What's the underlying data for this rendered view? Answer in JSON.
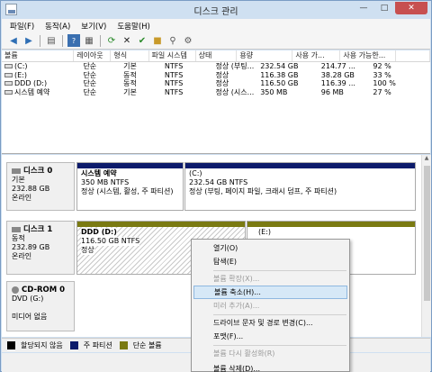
{
  "window": {
    "title": "디스크 관리"
  },
  "menu": [
    "파일(F)",
    "동작(A)",
    "보기(V)",
    "도움말(H)"
  ],
  "toolbar": [
    "back-icon",
    "forward-icon",
    "list-icon",
    "help-icon",
    "properties-icon",
    "refresh-icon",
    "delete-icon",
    "check-icon",
    "open-icon",
    "search-icon",
    "settings-icon"
  ],
  "volume_list": {
    "headers": [
      "볼륨",
      "레이아웃",
      "형식",
      "파일 시스템",
      "상태",
      "용량",
      "사용 가...",
      "사용 가능한...",
      ""
    ],
    "rows": [
      [
        "(C:)",
        "단순",
        "기본",
        "NTFS",
        "정상 (부팅...",
        "232.54 GB",
        "214.77 ...",
        "92 %"
      ],
      [
        "(E:)",
        "단순",
        "동적",
        "NTFS",
        "정상",
        "116.38 GB",
        "38.28 GB",
        "33 %"
      ],
      [
        "DDD (D:)",
        "단순",
        "동적",
        "NTFS",
        "정상",
        "116.50 GB",
        "116.39 ...",
        "100 %"
      ],
      [
        "시스템 예약",
        "단순",
        "기본",
        "NTFS",
        "정상 (시스...",
        "350 MB",
        "96 MB",
        "27 %"
      ]
    ]
  },
  "disks": [
    {
      "name": "디스크 0",
      "type": "기본",
      "size": "232.88 GB",
      "status": "온라인",
      "partitions": [
        {
          "name": "시스템 예약",
          "size": "350 MB NTFS",
          "status": "정상 (시스템, 활성, 주 파티션)"
        },
        {
          "name": "(C:)",
          "size": "232.54 GB NTFS",
          "status": "정상 (부팅, 페이지 파일, 크래시 덤프, 주 파티션)"
        }
      ]
    },
    {
      "name": "디스크 1",
      "type": "동적",
      "size": "232.89 GB",
      "status": "온라인",
      "partitions": [
        {
          "name": "DDD  (D:)",
          "size": "116.50 GB NTFS",
          "status": "정상"
        },
        {
          "name": "(E:)",
          "size": "",
          "status": ""
        }
      ]
    },
    {
      "name": "CD-ROM 0",
      "type": "DVD (G:)",
      "size": "",
      "status": "미디어 없음",
      "partitions": []
    }
  ],
  "legend": [
    {
      "label": "할당되지 않음",
      "color": "#000000"
    },
    {
      "label": "주 파티션",
      "color": "#0c1b6b"
    },
    {
      "label": "단순 볼륨",
      "color": "#7a7a12"
    }
  ],
  "context_menu": [
    {
      "label": "열기(O)",
      "disabled": false
    },
    {
      "label": "탐색(E)",
      "disabled": false
    },
    {
      "label": "볼륨 확장(X)...",
      "disabled": true
    },
    {
      "label": "볼륨 축소(H)...",
      "disabled": false,
      "highlighted": true
    },
    {
      "label": "미러 추가(A)...",
      "disabled": true
    },
    {
      "label": "드라이브 문자 및 경로 변경(C)...",
      "disabled": false
    },
    {
      "label": "포맷(F)...",
      "disabled": false
    },
    {
      "label": "볼륨 다시 활성화(R)",
      "disabled": true
    },
    {
      "label": "볼륨 삭제(D)...",
      "disabled": false
    }
  ]
}
